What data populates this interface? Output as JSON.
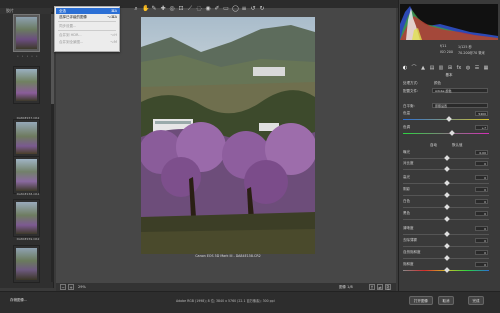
{
  "window": {
    "title": ""
  },
  "filmstrip": {
    "header": "胶片",
    "thumbs": [
      {
        "label": "",
        "stars": "• • • • •"
      },
      {
        "label": ""
      },
      {
        "label": "DA84E157.CR2"
      },
      {
        "label": "DA84E158.CR2"
      },
      {
        "label": "DA84E159.CR2"
      },
      {
        "label": "DA84E160.CR2"
      }
    ]
  },
  "context_menu": {
    "items": [
      {
        "label": "全选",
        "shortcut": "⌘A",
        "state": "active"
      },
      {
        "label": "选择已评级的图像",
        "shortcut": "⌥⌘A",
        "state": "normal"
      },
      {
        "label": "同步设置...",
        "shortcut": "",
        "state": "disabled"
      },
      {
        "label": "合并到 HDR...",
        "shortcut": "⌥H",
        "state": "disabled"
      },
      {
        "label": "合并到全景图...",
        "shortcut": "⌥M",
        "state": "disabled"
      }
    ]
  },
  "canvas": {
    "caption": "Canon EOS 5D Mark III - DA84E158.CR2",
    "zoom_label": "29%",
    "image_counter": "图像 1/8"
  },
  "histogram": {
    "f_stop": "f/11",
    "shutter": "1/125 秒",
    "iso": "ISO 200",
    "lens": "70-200@70 毫米"
  },
  "panel": {
    "title": "基本",
    "profile_label": "处理方式:",
    "profile_value": "颜色",
    "camera_label": "配置文件:",
    "camera_value": "Adobe 颜色",
    "wb_label": "白平衡:",
    "wb_value": "原照设置",
    "sliders": [
      {
        "label": "色温",
        "value": "5400",
        "pos": 0.52
      },
      {
        "label": "色调",
        "value": "+7",
        "pos": 0.55
      },
      {
        "label": "曝光",
        "value": "0.00",
        "pos": 0.5
      },
      {
        "label": "对比度",
        "value": "0",
        "pos": 0.5
      },
      {
        "label": "高光",
        "value": "0",
        "pos": 0.5
      },
      {
        "label": "阴影",
        "value": "0",
        "pos": 0.5
      },
      {
        "label": "白色",
        "value": "0",
        "pos": 0.5
      },
      {
        "label": "黑色",
        "value": "0",
        "pos": 0.5
      },
      {
        "label": "清晰度",
        "value": "0",
        "pos": 0.5
      },
      {
        "label": "去除薄雾",
        "value": "0",
        "pos": 0.5
      },
      {
        "label": "自然饱和度",
        "value": "0",
        "pos": 0.5
      },
      {
        "label": "饱和度",
        "value": "0",
        "pos": 0.5
      }
    ],
    "auto_label": "自动",
    "default_label": "默认值"
  },
  "statusbar": {
    "left_button": "存储图像...",
    "info": "Adobe RGB (1998); 8 位; 3840 x 5760 (22.1 百万像素); 300 ppi",
    "open_button": "打开图像",
    "cancel_button": "取消",
    "done_button": "完成"
  },
  "colors": {
    "menu_highlight": "#2b6fd5",
    "accent_blue": "#2b6fd5"
  }
}
